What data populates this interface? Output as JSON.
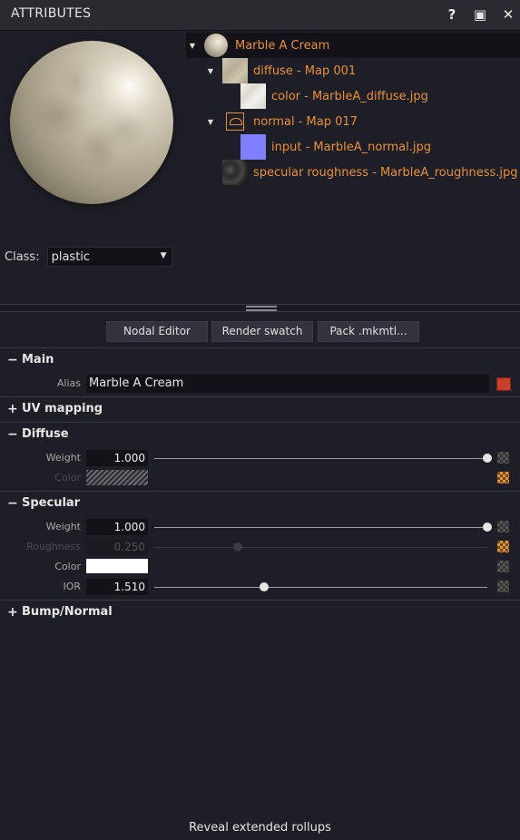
{
  "titlebar": {
    "title": "ATTRIBUTES",
    "help_label": "?",
    "restore_label": "▣",
    "close_label": "✕"
  },
  "class": {
    "label": "Class:",
    "value": "plastic"
  },
  "tree": {
    "material": "Marble A Cream",
    "diffuse": "diffuse - Map 001",
    "diffuse_color": "color - MarbleA_diffuse.jpg",
    "normal": "normal - Map 017",
    "normal_input": "input - MarbleA_normal.jpg",
    "specular_roughness": "specular roughness - MarbleA_roughness.jpg"
  },
  "toolbar": {
    "nodal_editor": "Nodal Editor",
    "render_swatch": "Render swatch",
    "pack": "Pack .mkmtl..."
  },
  "sections": {
    "main": {
      "sign": "−",
      "name": "Main"
    },
    "uv": {
      "sign": "+",
      "name": "UV mapping"
    },
    "diffuse": {
      "sign": "−",
      "name": "Diffuse"
    },
    "specular": {
      "sign": "−",
      "name": "Specular"
    },
    "bump": {
      "sign": "+",
      "name": "Bump/Normal"
    }
  },
  "main": {
    "alias_label": "Alias",
    "alias_value": "Marble A Cream",
    "alias_color": "#c8402c"
  },
  "diffuse": {
    "weight_label": "Weight",
    "weight_value": "1.000",
    "weight_level": 1.0,
    "color_label": "Color"
  },
  "specular": {
    "weight_label": "Weight",
    "weight_value": "1.000",
    "weight_level": 1.0,
    "roughness_label": "Roughness",
    "roughness_value": "0.250",
    "roughness_level": 0.25,
    "color_label": "Color",
    "color_value": "#ffffff",
    "ior_label": "IOR",
    "ior_value": "1.510",
    "ior_level": 0.33
  },
  "accent_color": "#e8903c",
  "footer": {
    "label": "Reveal extended rollups"
  }
}
